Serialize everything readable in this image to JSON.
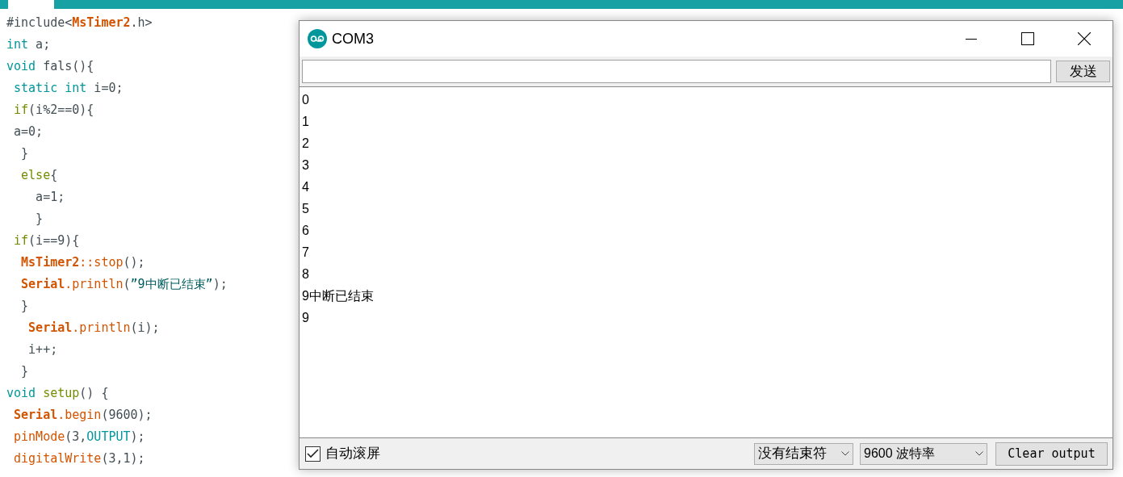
{
  "editor": {
    "tabs": [
      {
        "selected": true
      }
    ],
    "lines": [
      [
        {
          "kind": "plain",
          "text": "#include<"
        },
        {
          "kind": "class",
          "text": "MsTimer2"
        },
        {
          "kind": "plain",
          "text": ".h>"
        }
      ],
      [
        {
          "kind": "keyword",
          "text": "int"
        },
        {
          "kind": "plain",
          "text": " a;"
        }
      ],
      [
        {
          "kind": "keyword",
          "text": "void"
        },
        {
          "kind": "plain",
          "text": " fals(){"
        }
      ],
      [
        {
          "kind": "keyword",
          "text": " static int"
        },
        {
          "kind": "plain",
          "text": " i=0;"
        }
      ],
      [
        {
          "kind": "control",
          "text": " if"
        },
        {
          "kind": "plain",
          "text": "(i%2==0){"
        }
      ],
      [
        {
          "kind": "plain",
          "text": " a=0;"
        }
      ],
      [
        {
          "kind": "plain",
          "text": "  }"
        }
      ],
      [
        {
          "kind": "control",
          "text": "  else"
        },
        {
          "kind": "plain",
          "text": "{"
        }
      ],
      [
        {
          "kind": "plain",
          "text": "    a=1;"
        }
      ],
      [
        {
          "kind": "plain",
          "text": "    }"
        }
      ],
      [
        {
          "kind": "control",
          "text": " if"
        },
        {
          "kind": "plain",
          "text": "(i==9){"
        }
      ],
      [
        {
          "kind": "class",
          "text": "  MsTimer2"
        },
        {
          "kind": "function",
          "text": "::stop"
        },
        {
          "kind": "plain",
          "text": "();"
        }
      ],
      [
        {
          "kind": "class",
          "text": "  Serial"
        },
        {
          "kind": "function",
          "text": ".println"
        },
        {
          "kind": "plain",
          "text": "("
        },
        {
          "kind": "string",
          "text": "”9中断已结束”"
        },
        {
          "kind": "plain",
          "text": ");"
        }
      ],
      [
        {
          "kind": "plain",
          "text": "  }"
        }
      ],
      [
        {
          "kind": "class",
          "text": "   Serial"
        },
        {
          "kind": "function",
          "text": ".println"
        },
        {
          "kind": "plain",
          "text": "(i);"
        }
      ],
      [
        {
          "kind": "plain",
          "text": "   i++;"
        }
      ],
      [
        {
          "kind": "plain",
          "text": "  }"
        }
      ],
      [
        {
          "kind": "keyword",
          "text": "void"
        },
        {
          "kind": "control",
          "text": " setup"
        },
        {
          "kind": "plain",
          "text": "() {"
        }
      ],
      [
        {
          "kind": "class",
          "text": " Serial"
        },
        {
          "kind": "function",
          "text": ".begin"
        },
        {
          "kind": "plain",
          "text": "(9600);"
        }
      ],
      [
        {
          "kind": "function",
          "text": " pinMode"
        },
        {
          "kind": "plain",
          "text": "(3,"
        },
        {
          "kind": "keyword",
          "text": "OUTPUT"
        },
        {
          "kind": "plain",
          "text": ");"
        }
      ],
      [
        {
          "kind": "function",
          "text": " digitalWrite"
        },
        {
          "kind": "plain",
          "text": "(3,1);"
        }
      ]
    ]
  },
  "serial_monitor": {
    "window": {
      "title": "COM3"
    },
    "send_button": "发送",
    "output": [
      "0",
      "1",
      "2",
      "3",
      "4",
      "5",
      "6",
      "7",
      "8",
      "9中断已结束",
      "9"
    ],
    "autoscroll": {
      "label": "自动滚屏",
      "checked": true
    },
    "line_ending": "没有结束符",
    "baud_rate": "9600 波特率",
    "clear_button": "Clear output"
  }
}
